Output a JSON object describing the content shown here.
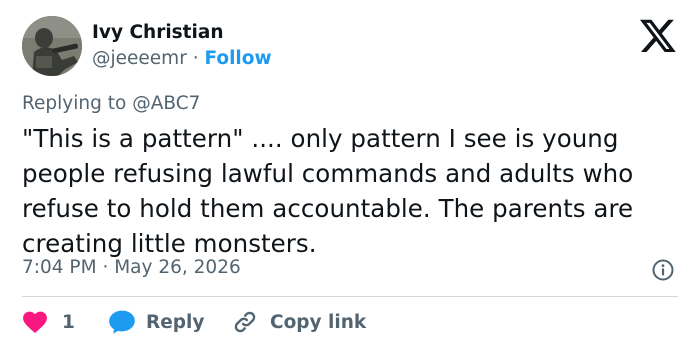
{
  "author": {
    "name": "Ivy Christian",
    "handle": "@jeeeemr",
    "separator": "·",
    "follow_label": "Follow"
  },
  "reply_context": {
    "prefix": "Replying to",
    "target": "@ABC7"
  },
  "tweet": {
    "text": "\"This is a pattern\" .... only pattern I see is young people refusing lawful commands and adults who refuse to hold them accountable. The parents are creating little monsters.",
    "time": "7:04 PM",
    "separator": "·",
    "date": "May 26, 2026"
  },
  "actions": {
    "like_count": "1",
    "reply_label": "Reply",
    "copy_label": "Copy link"
  },
  "colors": {
    "text_primary": "#0f1419",
    "text_secondary": "#536471",
    "accent": "#1d9bf0",
    "like": "#f91880",
    "divider": "#cfd9de"
  },
  "icons": {
    "brand": "x-logo-icon",
    "info": "info-icon",
    "like": "heart-icon",
    "reply": "speech-bubble-icon",
    "copy": "link-icon"
  }
}
